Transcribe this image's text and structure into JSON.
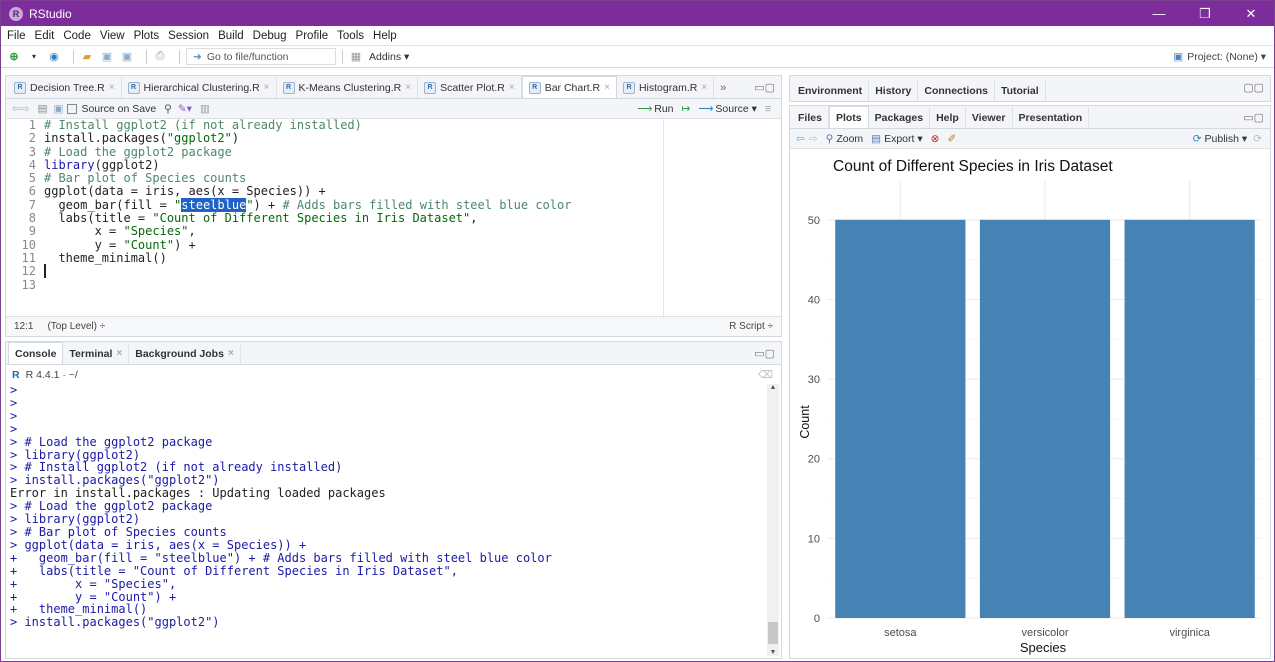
{
  "window": {
    "title": "RStudio",
    "minimize": "—",
    "restore": "❐",
    "close": "✕"
  },
  "menu": [
    "File",
    "Edit",
    "Code",
    "View",
    "Plots",
    "Session",
    "Build",
    "Debug",
    "Profile",
    "Tools",
    "Help"
  ],
  "toolbar": {
    "goto_placeholder": "Go to file/function",
    "addins": "Addins ▾",
    "project": "Project: (None) ▾"
  },
  "editor": {
    "tabs": [
      {
        "label": "Decision Tree.R"
      },
      {
        "label": "Hierarchical Clustering.R"
      },
      {
        "label": "K-Means Clustering.R"
      },
      {
        "label": "Scatter Plot.R"
      },
      {
        "label": "Bar Chart.R"
      },
      {
        "label": "Histogram.R"
      }
    ],
    "more": "»",
    "source_on_save": "Source on Save",
    "run": "Run",
    "source": "Source ▾",
    "line_numbers": [
      "1",
      "2",
      "3",
      "4",
      "5",
      "6",
      "7",
      "8",
      "9",
      "10",
      "11",
      "12",
      "13"
    ],
    "status_pos": "12:1",
    "status_scope": "(Top Level) ÷",
    "status_type": "R Script ÷"
  },
  "console": {
    "tabs": [
      {
        "label": "Console"
      },
      {
        "label": "Terminal"
      },
      {
        "label": "Background Jobs"
      }
    ],
    "version": "R 4.4.1 · ~/"
  },
  "env_pane": {
    "tabs": [
      "Environment",
      "History",
      "Connections",
      "Tutorial"
    ]
  },
  "files_pane": {
    "tabs": [
      "Files",
      "Plots",
      "Packages",
      "Help",
      "Viewer",
      "Presentation"
    ],
    "zoom": "Zoom",
    "export": "Export ▾",
    "publish": "Publish ▾"
  },
  "colors": {
    "bar": "#4682b4",
    "title_bar": "#7d2c9c"
  },
  "chart_data": {
    "type": "bar",
    "title": "Count of Different Species in Iris Dataset",
    "xlabel": "Species",
    "ylabel": "Count",
    "categories": [
      "setosa",
      "versicolor",
      "virginica"
    ],
    "values": [
      50,
      50,
      50
    ],
    "ylim": [
      0,
      55
    ],
    "yticks": [
      0,
      10,
      20,
      30,
      40,
      50
    ],
    "grid": true
  }
}
